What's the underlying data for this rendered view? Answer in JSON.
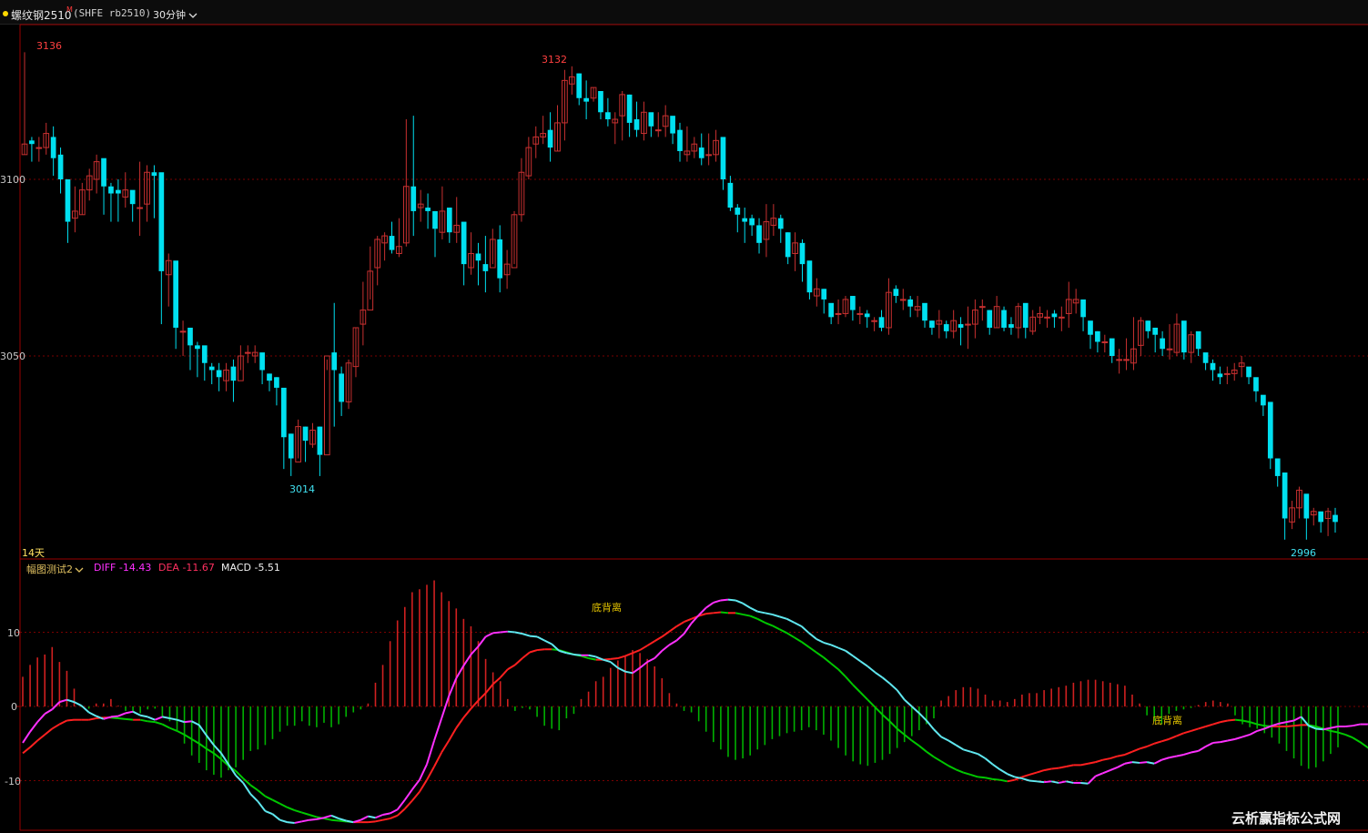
{
  "header": {
    "instrument": "螺纹钢2510",
    "badge": "M",
    "code": "(SHFE rb2510)",
    "period_label": "30分钟"
  },
  "main_panel": {
    "y_ticks": [
      "3100",
      "3050"
    ],
    "high_label": "3136",
    "peak_label": "3132",
    "low_label": "3014",
    "last_low_label": "2996",
    "days_label": "14天"
  },
  "indicator_panel": {
    "name": "幅图测试2",
    "diff_label": "DIFF -14.43",
    "dea_label": "DEA -11.67",
    "macd_label": "MACD -5.51",
    "y_ticks": [
      "10",
      "0",
      "-10"
    ],
    "divergence_labels": [
      "底背离",
      "底背离"
    ]
  },
  "colors": {
    "up": "#ff3c3c",
    "down": "#00e0f0",
    "diff_up": "#ff30ff",
    "diff_down": "#60e8f0",
    "dea_up": "#ff2020",
    "dea_down": "#00c800",
    "hist_up": "#d02020",
    "hist_down": "#00b000",
    "grid": "#7a0000",
    "frame": "#9a0000"
  },
  "watermark": "云析赢指标公式网",
  "chart_data": [
    {
      "type": "candlestick",
      "title": "",
      "ylim": [
        2996,
        3136
      ],
      "y_ticks": [
        3100,
        3050
      ],
      "closes": [
        3110,
        3110,
        3109,
        3113,
        3106,
        3100,
        3088,
        3091,
        3097,
        3101,
        3105,
        3098,
        3096,
        3096,
        3097,
        3093,
        3092,
        3102,
        3101,
        3074,
        3077,
        3058,
        3057,
        3053,
        3052,
        3048,
        3046,
        3044,
        3046,
        3043,
        3050,
        3051,
        3051,
        3046,
        3043,
        3041,
        3027,
        3021,
        3030,
        3026,
        3029,
        3022,
        3050,
        3046,
        3037,
        3048,
        3058,
        3063,
        3074,
        3083,
        3084,
        3080,
        3081,
        3098,
        3091,
        3093,
        3091,
        3086,
        3091,
        3085,
        3087,
        3076,
        3079,
        3077,
        3074,
        3083,
        3072,
        3076,
        3090,
        3102,
        3109,
        3112,
        3113,
        3109,
        3116,
        3128,
        3129,
        3123,
        3122,
        3126,
        3119,
        3117,
        3117,
        3124,
        3116,
        3114,
        3119,
        3115,
        3114,
        3118,
        3113,
        3108,
        3108,
        3110,
        3106,
        3107,
        3111,
        3100,
        3092,
        3090,
        3088,
        3087,
        3082,
        3088,
        3089,
        3086,
        3078,
        3082,
        3076,
        3068,
        3069,
        3066,
        3061,
        3062,
        3066,
        3063,
        3062,
        3061,
        3060,
        3058,
        3068,
        3067,
        3066,
        3064,
        3064,
        3060,
        3058,
        3060,
        3057,
        3060,
        3058,
        3059,
        3063,
        3064,
        3058,
        3064,
        3058,
        3058,
        3064,
        3058,
        3061,
        3062,
        3061,
        3061,
        3061,
        3066,
        3066,
        3061,
        3056,
        3054,
        3054,
        3050,
        3049,
        3049,
        3052,
        3060,
        3057,
        3056,
        3052,
        3052,
        3059,
        3051,
        3056,
        3052,
        3048,
        3046,
        3044,
        3045,
        3046,
        3048,
        3044,
        3040,
        3036,
        3021,
        3016,
        3004,
        3007,
        3012,
        3004,
        3006,
        3003,
        3006,
        3003
      ],
      "highs": [
        3136,
        3112,
        3112,
        3116,
        3115,
        3109,
        3100,
        3098,
        3099,
        3103,
        3107,
        3101,
        3099,
        3100,
        3102,
        3095,
        3105,
        3104,
        3104,
        3083,
        3079,
        3063,
        3060,
        3055,
        3054,
        3050,
        3048,
        3048,
        3048,
        3049,
        3053,
        3053,
        3053,
        3048,
        3045,
        3044,
        3031,
        3028,
        3032,
        3030,
        3031,
        3030,
        3049,
        3065,
        3047,
        3049,
        3058,
        3071,
        3081,
        3084,
        3085,
        3088,
        3089,
        3117,
        3118,
        3097,
        3096,
        3091,
        3098,
        3091,
        3095,
        3083,
        3085,
        3082,
        3084,
        3086,
        3087,
        3080,
        3091,
        3106,
        3112,
        3115,
        3118,
        3119,
        3121,
        3131,
        3132,
        3130,
        3128,
        3126,
        3125,
        3123,
        3119,
        3125,
        3124,
        3122,
        3122,
        3118,
        3119,
        3121,
        3116,
        3116,
        3115,
        3112,
        3113,
        3113,
        3114,
        3106,
        3101,
        3093,
        3092,
        3090,
        3089,
        3093,
        3093,
        3090,
        3085,
        3085,
        3083,
        3071,
        3072,
        3069,
        3064,
        3066,
        3067,
        3066,
        3064,
        3063,
        3061,
        3063,
        3072,
        3070,
        3069,
        3067,
        3067,
        3064,
        3060,
        3063,
        3060,
        3063,
        3061,
        3064,
        3066,
        3066,
        3063,
        3067,
        3064,
        3061,
        3065,
        3062,
        3063,
        3064,
        3063,
        3063,
        3064,
        3071,
        3069,
        3064,
        3058,
        3057,
        3056,
        3053,
        3052,
        3055,
        3061,
        3061,
        3060,
        3058,
        3057,
        3059,
        3062,
        3055,
        3057,
        3054,
        3050,
        3049,
        3047,
        3047,
        3048,
        3050,
        3046,
        3042,
        3038,
        3025,
        3017,
        3007,
        3009,
        3013,
        3006,
        3007,
        3005,
        3007,
        3007
      ],
      "lows": [
        3107,
        3105,
        3105,
        3107,
        3101,
        3096,
        3082,
        3085,
        3090,
        3094,
        3096,
        3090,
        3088,
        3088,
        3092,
        3088,
        3084,
        3088,
        3089,
        3059,
        3064,
        3052,
        3050,
        3046,
        3044,
        3043,
        3042,
        3040,
        3040,
        3037,
        3046,
        3048,
        3048,
        3042,
        3040,
        3036,
        3018,
        3016,
        3021,
        3020,
        3024,
        3016,
        3046,
        3030,
        3033,
        3035,
        3044,
        3053,
        3066,
        3070,
        3077,
        3079,
        3078,
        3081,
        3084,
        3088,
        3086,
        3078,
        3083,
        3082,
        3082,
        3070,
        3073,
        3070,
        3068,
        3076,
        3068,
        3069,
        3076,
        3088,
        3100,
        3106,
        3110,
        3105,
        3108,
        3111,
        3124,
        3121,
        3117,
        3122,
        3117,
        3115,
        3110,
        3111,
        3112,
        3112,
        3111,
        3112,
        3112,
        3112,
        3110,
        3105,
        3105,
        3106,
        3104,
        3104,
        3105,
        3097,
        3091,
        3085,
        3082,
        3084,
        3079,
        3078,
        3084,
        3082,
        3076,
        3074,
        3071,
        3066,
        3064,
        3062,
        3059,
        3059,
        3061,
        3060,
        3059,
        3058,
        3057,
        3057,
        3056,
        3065,
        3063,
        3061,
        3061,
        3058,
        3056,
        3055,
        3055,
        3055,
        3053,
        3052,
        3055,
        3060,
        3056,
        3058,
        3057,
        3056,
        3055,
        3055,
        3056,
        3059,
        3058,
        3058,
        3057,
        3058,
        3062,
        3057,
        3052,
        3051,
        3051,
        3048,
        3045,
        3046,
        3046,
        3050,
        3055,
        3051,
        3050,
        3049,
        3050,
        3049,
        3048,
        3050,
        3046,
        3043,
        3042,
        3042,
        3043,
        3044,
        3042,
        3037,
        3033,
        3018,
        3013,
        2998,
        3001,
        3004,
        2998,
        3002,
        3000,
        2999,
        3000
      ]
    },
    {
      "type": "line",
      "title": "",
      "ylim": [
        -16,
        17
      ],
      "y_ticks": [
        10,
        0,
        -10
      ],
      "series": [
        {
          "name": "DIFF",
          "values": [
            -4.9,
            -3.4,
            -2.1,
            -1.0,
            -0.4,
            0.6,
            0.9,
            0.6,
            0.1,
            -0.8,
            -1.3,
            -1.7,
            -1.4,
            -1.3,
            -0.9,
            -0.7,
            -1.2,
            -1.4,
            -1.8,
            -1.4,
            -1.6,
            -1.8,
            -2.1,
            -2.0,
            -2.5,
            -3.9,
            -5.2,
            -6.3,
            -7.8,
            -9.3,
            -10.3,
            -11.8,
            -12.8,
            -14.1,
            -14.5,
            -15.3,
            -15.6,
            -15.7,
            -15.5,
            -15.3,
            -15.2,
            -15.0,
            -14.7,
            -15.1,
            -15.4,
            -15.6,
            -15.3,
            -14.8,
            -15.0,
            -14.6,
            -14.4,
            -13.9,
            -12.6,
            -11.2,
            -9.9,
            -7.8,
            -4.6,
            -1.6,
            1.4,
            3.8,
            5.5,
            7.0,
            8.1,
            9.4,
            9.9,
            10.0,
            10.1,
            10.0,
            9.8,
            9.5,
            9.4,
            8.9,
            8.4,
            7.5,
            7.2,
            7.0,
            6.9,
            6.9,
            6.7,
            6.3,
            6.0,
            5.2,
            4.7,
            4.5,
            5.2,
            6.0,
            6.5,
            7.5,
            8.3,
            8.9,
            9.8,
            11.2,
            12.3,
            13.3,
            14.0,
            14.3,
            14.4,
            14.3,
            13.9,
            13.3,
            12.8,
            12.6,
            12.4,
            12.1,
            11.8,
            11.3,
            10.8,
            9.9,
            9.1,
            8.6,
            8.3,
            7.9,
            7.5,
            6.8,
            6.1,
            5.4,
            4.6,
            3.9,
            3.1,
            2.2,
            0.9,
            0.0,
            -0.9,
            -1.9,
            -3.1,
            -4.1,
            -4.6,
            -5.2,
            -5.8,
            -6.1,
            -6.4,
            -7.0,
            -7.8,
            -8.5,
            -9.1,
            -9.5,
            -9.7,
            -10.0,
            -10.1,
            -10.2,
            -10.1,
            -10.3,
            -10.1,
            -10.3,
            -10.3,
            -10.4,
            -9.4,
            -9.0,
            -8.6,
            -8.2,
            -7.7,
            -7.5,
            -7.6,
            -7.5,
            -7.7,
            -7.2,
            -6.9,
            -6.7,
            -6.5,
            -6.2,
            -6.0,
            -5.4,
            -4.9,
            -4.8,
            -4.6,
            -4.4,
            -4.1,
            -3.8,
            -3.3,
            -3.0,
            -2.6,
            -2.3,
            -2.1,
            -1.9,
            -1.4,
            -2.6,
            -3.0,
            -3.1,
            -2.9,
            -2.7,
            -2.7,
            -2.6,
            -2.4,
            -2.4,
            -2.4,
            -3.1,
            -3.5,
            -3.8,
            -4.5,
            -5.0,
            -6.2,
            -7.9,
            -9.6,
            -11.3,
            -12.4,
            -13.3,
            -13.9,
            -14.4
          ]
        },
        {
          "name": "DEA",
          "values": [
            -6.3,
            -5.5,
            -4.6,
            -3.8,
            -3.0,
            -2.4,
            -1.9,
            -1.8,
            -1.8,
            -1.8,
            -1.6,
            -1.5,
            -1.5,
            -1.6,
            -1.7,
            -1.8,
            -1.8,
            -2.0,
            -2.1,
            -2.4,
            -2.9,
            -3.3,
            -3.8,
            -4.4,
            -5.0,
            -5.7,
            -6.3,
            -7.1,
            -8.0,
            -8.7,
            -9.7,
            -10.6,
            -11.3,
            -12.1,
            -12.6,
            -13.1,
            -13.6,
            -14.0,
            -14.3,
            -14.6,
            -14.9,
            -15.1,
            -15.3,
            -15.4,
            -15.5,
            -15.6,
            -15.6,
            -15.6,
            -15.5,
            -15.3,
            -15.1,
            -14.7,
            -13.8,
            -12.7,
            -11.5,
            -9.9,
            -8.1,
            -6.2,
            -4.6,
            -2.9,
            -1.5,
            -0.3,
            0.8,
            1.8,
            3.0,
            3.9,
            5.0,
            5.6,
            6.5,
            7.3,
            7.6,
            7.7,
            7.7,
            7.6,
            7.3,
            7.0,
            6.8,
            6.5,
            6.3,
            6.3,
            6.4,
            6.5,
            6.8,
            7.2,
            7.6,
            8.2,
            8.8,
            9.4,
            10.1,
            10.8,
            11.4,
            11.8,
            12.2,
            12.5,
            12.6,
            12.7,
            12.6,
            12.6,
            12.4,
            12.2,
            11.8,
            11.3,
            10.9,
            10.4,
            9.9,
            9.3,
            8.7,
            8.0,
            7.3,
            6.6,
            5.8,
            5.0,
            4.0,
            2.9,
            1.9,
            0.9,
            -0.1,
            -1.1,
            -2.0,
            -3.0,
            -3.8,
            -4.6,
            -5.3,
            -6.1,
            -6.8,
            -7.4,
            -8.0,
            -8.5,
            -8.9,
            -9.2,
            -9.5,
            -9.6,
            -9.8,
            -9.9,
            -10.1,
            -9.9,
            -9.5,
            -9.2,
            -8.9,
            -8.6,
            -8.4,
            -8.3,
            -8.1,
            -7.9,
            -7.9,
            -7.7,
            -7.5,
            -7.2,
            -7.0,
            -6.7,
            -6.5,
            -6.1,
            -5.7,
            -5.4,
            -5.0,
            -4.7,
            -4.4,
            -4.0,
            -3.6,
            -3.3,
            -3.0,
            -2.7,
            -2.4,
            -2.1,
            -1.9,
            -1.8,
            -1.9,
            -2.1,
            -2.4,
            -2.6,
            -2.7,
            -2.7,
            -2.7,
            -2.6,
            -2.5,
            -2.5,
            -2.7,
            -3.0,
            -3.3,
            -3.5,
            -3.8,
            -4.2,
            -4.8,
            -5.5,
            -6.2,
            -7.0,
            -8.0,
            -9.2,
            -10.3,
            -11.2,
            -11.67
          ]
        },
        {
          "name": "MACD",
          "values": [
            4.0,
            5.6,
            6.6,
            7.0,
            8.0,
            6.0,
            4.8,
            2.4,
            -0.1,
            -0.3,
            0.4,
            0.4,
            1.0,
            0.1,
            -0.6,
            -0.7,
            -0.9,
            -0.4,
            -0.3,
            -1.4,
            -2.0,
            -3.2,
            -5.0,
            -6.6,
            -7.6,
            -8.6,
            -9.2,
            -9.6,
            -8.6,
            -8.2,
            -7.2,
            -6.0,
            -5.8,
            -5.2,
            -4.4,
            -3.4,
            -2.6,
            -2.6,
            -2.0,
            -2.6,
            -2.8,
            -2.2,
            -2.8,
            -2.4,
            -1.4,
            -0.8,
            -0.4,
            0.4,
            3.2,
            5.6,
            8.8,
            11.6,
            13.4,
            15.4,
            15.8,
            16.4,
            17.0,
            15.4,
            14.2,
            13.2,
            11.8,
            10.8,
            8.8,
            6.4,
            4.6,
            3.4,
            1.0,
            -0.6,
            -0.2,
            -0.4,
            -1.4,
            -2.6,
            -3.0,
            -3.2,
            -1.6,
            -1.0,
            1.0,
            2.0,
            3.4,
            4.0,
            5.2,
            6.2,
            6.8,
            7.6,
            7.2,
            6.4,
            5.4,
            3.8,
            1.8,
            0.4,
            -0.6,
            -0.8,
            -2.0,
            -3.4,
            -4.8,
            -5.8,
            -6.8,
            -7.2,
            -7.0,
            -6.6,
            -5.8,
            -5.2,
            -4.4,
            -4.0,
            -3.6,
            -3.4,
            -3.2,
            -2.8,
            -3.2,
            -3.8,
            -4.6,
            -5.6,
            -6.6,
            -7.4,
            -7.8,
            -8.0,
            -7.6,
            -7.2,
            -6.4,
            -5.6,
            -4.8,
            -4.0,
            -3.2,
            -2.4,
            -1.6,
            0.8,
            1.4,
            2.2,
            2.6,
            2.6,
            2.4,
            1.6,
            0.8,
            0.8,
            0.6,
            1.0,
            1.6,
            1.8,
            1.8,
            2.2,
            2.4,
            2.6,
            2.8,
            3.2,
            3.4,
            3.6,
            3.6,
            3.4,
            3.2,
            3.0,
            2.8,
            1.6,
            0.4,
            -1.2,
            -2.0,
            -2.4,
            -1.0,
            -0.6,
            -0.4,
            -0.2,
            0.2,
            0.6,
            0.8,
            0.6,
            0.4,
            -1.2,
            -2.4,
            -2.8,
            -3.0,
            -3.6,
            -4.2,
            -5.0,
            -6.0,
            -7.0,
            -8.0,
            -8.4,
            -8.2,
            -7.4,
            -6.4,
            -5.51
          ]
        }
      ]
    }
  ]
}
